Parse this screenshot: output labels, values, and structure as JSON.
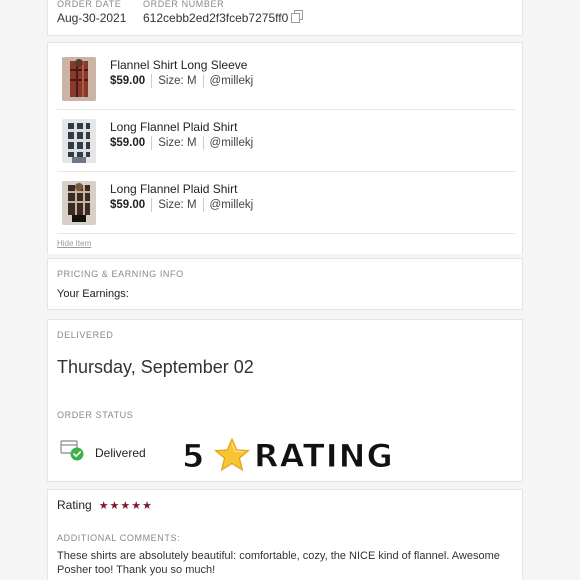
{
  "order": {
    "date_label": "ORDER DATE",
    "date": "Aug-30-2021",
    "number_label": "ORDER NUMBER",
    "number": "612cebb2ed2f3fceb7275ff0"
  },
  "items": [
    {
      "title": "Flannel Shirt Long Sleeve",
      "price": "$59.00",
      "size": "Size: M",
      "seller": "@millekj"
    },
    {
      "title": "Long Flannel Plaid Shirt",
      "price": "$59.00",
      "size": "Size: M",
      "seller": "@millekj"
    },
    {
      "title": "Long Flannel Plaid Shirt",
      "price": "$59.00",
      "size": "Size: M",
      "seller": "@millekj"
    }
  ],
  "hide_item": "Hide Item",
  "pricing": {
    "label": "PRICING & EARNING INFO",
    "earnings": "Your Earnings:"
  },
  "delivery": {
    "label": "DELIVERED",
    "date": "Thursday, September 02",
    "status_label": "ORDER STATUS",
    "status": "Delivered"
  },
  "banner": {
    "five": "5",
    "word": "RATING"
  },
  "rating": {
    "label": "Rating",
    "stars": "★★★★★",
    "comments_label": "ADDITIONAL COMMENTS:",
    "comment": "These shirts are absolutely beautiful: comfortable, cozy, the NICE kind of flannel. Awesome Posher too! Thank you so much!"
  },
  "colors": {
    "star": "#7a1b2c",
    "status_check": "#3bb34a"
  },
  "icons": {
    "copy": "copy-icon",
    "delivered": "package-check-icon",
    "banner_star": "star-emoji-icon"
  }
}
